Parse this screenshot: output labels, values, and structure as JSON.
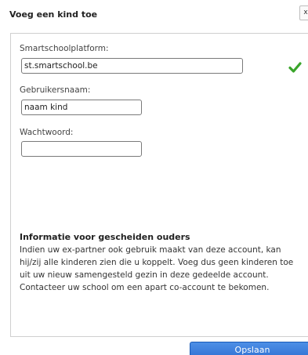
{
  "dialog": {
    "title": "Voeg een kind toe",
    "close_label": "x"
  },
  "form": {
    "platform": {
      "label": "Smartschoolplatform:",
      "value": "st.smartschool.be",
      "valid": true
    },
    "username": {
      "label": "Gebruikersnaam:",
      "value": "naam kind"
    },
    "password": {
      "label": "Wachtwoord:",
      "value": ""
    }
  },
  "info": {
    "title": "Informatie voor gescheiden ouders",
    "text": "Indien uw ex-partner ook gebruik maakt van deze account, kan hij/zij alle kinderen zien die u koppelt. Voeg dus geen kinderen toe uit uw nieuw samengesteld gezin in deze gedeelde account. Contacteer uw school om een apart co-account te bekomen."
  },
  "actions": {
    "save_label": "Opslaan"
  },
  "colors": {
    "accent": "#2e6fd1",
    "valid": "#3aa52b"
  },
  "icons": {
    "platform_status": "checkmark-icon"
  }
}
